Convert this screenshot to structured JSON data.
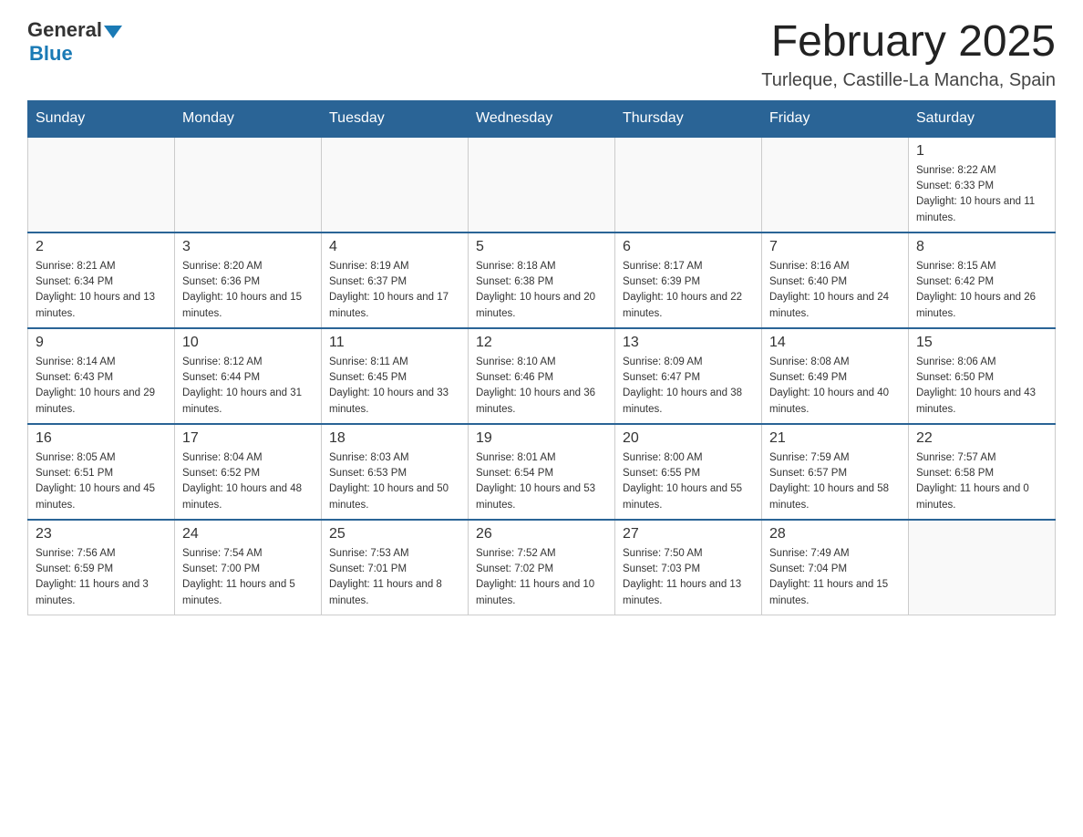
{
  "logo": {
    "general": "General",
    "blue": "Blue"
  },
  "title": "February 2025",
  "subtitle": "Turleque, Castille-La Mancha, Spain",
  "days_of_week": [
    "Sunday",
    "Monday",
    "Tuesday",
    "Wednesday",
    "Thursday",
    "Friday",
    "Saturday"
  ],
  "weeks": [
    [
      {
        "day": "",
        "info": "",
        "empty": true
      },
      {
        "day": "",
        "info": "",
        "empty": true
      },
      {
        "day": "",
        "info": "",
        "empty": true
      },
      {
        "day": "",
        "info": "",
        "empty": true
      },
      {
        "day": "",
        "info": "",
        "empty": true
      },
      {
        "day": "",
        "info": "",
        "empty": true
      },
      {
        "day": "1",
        "info": "Sunrise: 8:22 AM\nSunset: 6:33 PM\nDaylight: 10 hours and 11 minutes.",
        "empty": false
      }
    ],
    [
      {
        "day": "2",
        "info": "Sunrise: 8:21 AM\nSunset: 6:34 PM\nDaylight: 10 hours and 13 minutes.",
        "empty": false
      },
      {
        "day": "3",
        "info": "Sunrise: 8:20 AM\nSunset: 6:36 PM\nDaylight: 10 hours and 15 minutes.",
        "empty": false
      },
      {
        "day": "4",
        "info": "Sunrise: 8:19 AM\nSunset: 6:37 PM\nDaylight: 10 hours and 17 minutes.",
        "empty": false
      },
      {
        "day": "5",
        "info": "Sunrise: 8:18 AM\nSunset: 6:38 PM\nDaylight: 10 hours and 20 minutes.",
        "empty": false
      },
      {
        "day": "6",
        "info": "Sunrise: 8:17 AM\nSunset: 6:39 PM\nDaylight: 10 hours and 22 minutes.",
        "empty": false
      },
      {
        "day": "7",
        "info": "Sunrise: 8:16 AM\nSunset: 6:40 PM\nDaylight: 10 hours and 24 minutes.",
        "empty": false
      },
      {
        "day": "8",
        "info": "Sunrise: 8:15 AM\nSunset: 6:42 PM\nDaylight: 10 hours and 26 minutes.",
        "empty": false
      }
    ],
    [
      {
        "day": "9",
        "info": "Sunrise: 8:14 AM\nSunset: 6:43 PM\nDaylight: 10 hours and 29 minutes.",
        "empty": false
      },
      {
        "day": "10",
        "info": "Sunrise: 8:12 AM\nSunset: 6:44 PM\nDaylight: 10 hours and 31 minutes.",
        "empty": false
      },
      {
        "day": "11",
        "info": "Sunrise: 8:11 AM\nSunset: 6:45 PM\nDaylight: 10 hours and 33 minutes.",
        "empty": false
      },
      {
        "day": "12",
        "info": "Sunrise: 8:10 AM\nSunset: 6:46 PM\nDaylight: 10 hours and 36 minutes.",
        "empty": false
      },
      {
        "day": "13",
        "info": "Sunrise: 8:09 AM\nSunset: 6:47 PM\nDaylight: 10 hours and 38 minutes.",
        "empty": false
      },
      {
        "day": "14",
        "info": "Sunrise: 8:08 AM\nSunset: 6:49 PM\nDaylight: 10 hours and 40 minutes.",
        "empty": false
      },
      {
        "day": "15",
        "info": "Sunrise: 8:06 AM\nSunset: 6:50 PM\nDaylight: 10 hours and 43 minutes.",
        "empty": false
      }
    ],
    [
      {
        "day": "16",
        "info": "Sunrise: 8:05 AM\nSunset: 6:51 PM\nDaylight: 10 hours and 45 minutes.",
        "empty": false
      },
      {
        "day": "17",
        "info": "Sunrise: 8:04 AM\nSunset: 6:52 PM\nDaylight: 10 hours and 48 minutes.",
        "empty": false
      },
      {
        "day": "18",
        "info": "Sunrise: 8:03 AM\nSunset: 6:53 PM\nDaylight: 10 hours and 50 minutes.",
        "empty": false
      },
      {
        "day": "19",
        "info": "Sunrise: 8:01 AM\nSunset: 6:54 PM\nDaylight: 10 hours and 53 minutes.",
        "empty": false
      },
      {
        "day": "20",
        "info": "Sunrise: 8:00 AM\nSunset: 6:55 PM\nDaylight: 10 hours and 55 minutes.",
        "empty": false
      },
      {
        "day": "21",
        "info": "Sunrise: 7:59 AM\nSunset: 6:57 PM\nDaylight: 10 hours and 58 minutes.",
        "empty": false
      },
      {
        "day": "22",
        "info": "Sunrise: 7:57 AM\nSunset: 6:58 PM\nDaylight: 11 hours and 0 minutes.",
        "empty": false
      }
    ],
    [
      {
        "day": "23",
        "info": "Sunrise: 7:56 AM\nSunset: 6:59 PM\nDaylight: 11 hours and 3 minutes.",
        "empty": false
      },
      {
        "day": "24",
        "info": "Sunrise: 7:54 AM\nSunset: 7:00 PM\nDaylight: 11 hours and 5 minutes.",
        "empty": false
      },
      {
        "day": "25",
        "info": "Sunrise: 7:53 AM\nSunset: 7:01 PM\nDaylight: 11 hours and 8 minutes.",
        "empty": false
      },
      {
        "day": "26",
        "info": "Sunrise: 7:52 AM\nSunset: 7:02 PM\nDaylight: 11 hours and 10 minutes.",
        "empty": false
      },
      {
        "day": "27",
        "info": "Sunrise: 7:50 AM\nSunset: 7:03 PM\nDaylight: 11 hours and 13 minutes.",
        "empty": false
      },
      {
        "day": "28",
        "info": "Sunrise: 7:49 AM\nSunset: 7:04 PM\nDaylight: 11 hours and 15 minutes.",
        "empty": false
      },
      {
        "day": "",
        "info": "",
        "empty": true
      }
    ]
  ]
}
